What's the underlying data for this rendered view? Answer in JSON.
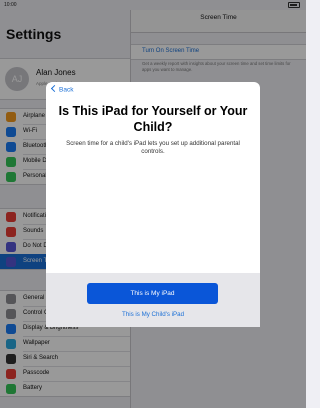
{
  "status": {
    "time": "10:00"
  },
  "settings": {
    "title": "Settings",
    "profile": {
      "initials": "AJ",
      "name": "Alan Jones",
      "subtitle": "Apple ID, iCloud, iTunes & App Store"
    },
    "groups": [
      {
        "items": [
          {
            "label": "Airplane Mode",
            "icon": "airplane-icon",
            "color": "#f39a1d"
          },
          {
            "label": "Wi-Fi",
            "icon": "wifi-icon",
            "color": "#1a7cf5"
          },
          {
            "label": "Bluetooth",
            "icon": "bluetooth-icon",
            "color": "#1a7cf5"
          },
          {
            "label": "Mobile Data",
            "icon": "antenna-icon",
            "color": "#35c759"
          },
          {
            "label": "Personal Hotspot",
            "icon": "hotspot-icon",
            "color": "#35c759"
          }
        ]
      },
      {
        "items": [
          {
            "label": "Notifications",
            "icon": "notifications-icon",
            "color": "#ea3c35"
          },
          {
            "label": "Sounds",
            "icon": "speaker-icon",
            "color": "#ea3c35"
          },
          {
            "label": "Do Not Disturb",
            "icon": "moon-icon",
            "color": "#5856d6"
          },
          {
            "label": "Screen Time",
            "icon": "hourglass-icon",
            "color": "#5856d6",
            "selected": true
          }
        ]
      },
      {
        "items": [
          {
            "label": "General",
            "icon": "gear-icon",
            "color": "#8e8e93"
          },
          {
            "label": "Control Centre",
            "icon": "sliders-icon",
            "color": "#8e8e93"
          },
          {
            "label": "Display & Brightness",
            "icon": "text-size-icon",
            "color": "#1a7cf5"
          },
          {
            "label": "Wallpaper",
            "icon": "flower-icon",
            "color": "#2aa8e0"
          },
          {
            "label": "Siri & Search",
            "icon": "siri-icon",
            "color": "#333333"
          },
          {
            "label": "Passcode",
            "icon": "lock-icon",
            "color": "#ea3c35"
          },
          {
            "label": "Battery",
            "icon": "battery-icon",
            "color": "#35c759"
          }
        ]
      }
    ]
  },
  "screen_time": {
    "nav_title": "Screen Time",
    "turn_on_label": "Turn On Screen Time",
    "turn_on_desc": "Get a weekly report with insights about your screen time and set time limits for apps you want to manage."
  },
  "modal": {
    "back_label": "Back",
    "title": "Is This iPad for Yourself or Your Child?",
    "subtitle": "Screen time for a child's iPad lets you set up additional parental controls.",
    "primary_button": "This is My iPad",
    "secondary_link": "This is My Child's iPad"
  },
  "colors": {
    "accent": "#1a6fd6",
    "primary_button": "#0a56d8"
  }
}
